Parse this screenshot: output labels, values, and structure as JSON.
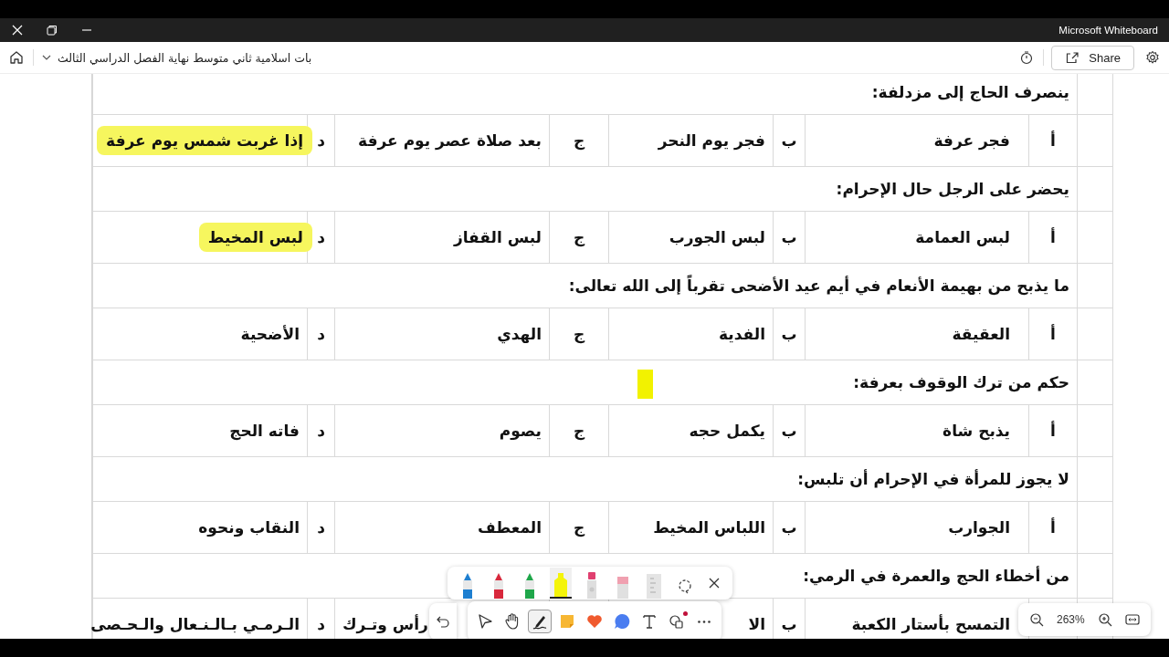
{
  "window": {
    "title": "Microsoft Whiteboard"
  },
  "header": {
    "board_name": "بات اسلامية ثاني متوسط نهاية الفصل الدراسي الثالث",
    "share_button": "Share"
  },
  "questions": [
    {
      "text": "ينصرف الحاج إلى مزدلفة:",
      "options": [
        {
          "letter": "أ",
          "text": "فجر عرفة",
          "highlighted": false
        },
        {
          "letter": "ب",
          "text": "فجر يوم النحر",
          "highlighted": false
        },
        {
          "letter": "ج",
          "text": "بعد صلاة عصر يوم عرفة",
          "highlighted": false
        },
        {
          "letter": "د",
          "text": "إذا غربت شمس يوم عرفة",
          "highlighted": true
        }
      ]
    },
    {
      "text": "يحضر على الرجل حال الإحرام:",
      "options": [
        {
          "letter": "أ",
          "text": "لبس العمامة",
          "highlighted": false
        },
        {
          "letter": "ب",
          "text": "لبس الجورب",
          "highlighted": false
        },
        {
          "letter": "ج",
          "text": "لبس القفاز",
          "highlighted": false
        },
        {
          "letter": "د",
          "text": "لبس المخيط",
          "highlighted": true
        }
      ]
    },
    {
      "text": "ما يذبح من بهيمة الأنعام في أيم عيد الأضحى تقرباً إلى الله تعالى:",
      "options": [
        {
          "letter": "أ",
          "text": "العقيقة",
          "highlighted": false
        },
        {
          "letter": "ب",
          "text": "الفدية",
          "highlighted": false
        },
        {
          "letter": "ج",
          "text": "الهدي",
          "highlighted": false
        },
        {
          "letter": "د",
          "text": "الأضحية",
          "highlighted": false
        }
      ]
    },
    {
      "text": "حكم من ترك الوقوف بعرفة:",
      "options": [
        {
          "letter": "أ",
          "text": "يذبح شاة",
          "highlighted": false
        },
        {
          "letter": "ب",
          "text": "يكمل حجه",
          "highlighted": false
        },
        {
          "letter": "ج",
          "text": "يصوم",
          "highlighted": false
        },
        {
          "letter": "د",
          "text": "فاته الحج",
          "highlighted": false
        }
      ]
    },
    {
      "text": "لا يجوز للمرأة في الإحرام أن تلبس:",
      "options": [
        {
          "letter": "أ",
          "text": "الجوارب",
          "highlighted": false
        },
        {
          "letter": "ب",
          "text": "اللباس المخيط",
          "highlighted": false
        },
        {
          "letter": "ج",
          "text": "المعطف",
          "highlighted": false
        },
        {
          "letter": "د",
          "text": "النقاب ونحوه",
          "highlighted": false
        }
      ]
    },
    {
      "text": "من أخطاء الحج والعمرة في الرمي:",
      "options": [
        {
          "text": "التمسح بأستار الكعبة",
          "highlighted": false
        },
        {
          "letter": "ب",
          "text": "الا",
          "highlighted": false
        },
        {
          "text": "رأس وتـرك",
          "highlighted": false
        },
        {
          "letter": "د",
          "text": "الـرمـي بـالـنـعال والـحـصى",
          "highlighted": false
        }
      ]
    }
  ],
  "pen_tray": [
    {
      "kind": "pen",
      "color": "#1e7fd0",
      "selected": false
    },
    {
      "kind": "pen",
      "color": "#d8283c",
      "selected": false
    },
    {
      "kind": "pen",
      "color": "#1fa64a",
      "selected": false
    },
    {
      "kind": "highlighter",
      "color": "#f4f40a",
      "selected": true
    },
    {
      "kind": "marker",
      "color": "#e04070",
      "selected": false
    },
    {
      "kind": "eraser",
      "color": "#f0a0b0",
      "selected": false
    },
    {
      "kind": "ruler",
      "selected": false
    },
    {
      "kind": "lasso",
      "selected": false
    }
  ],
  "toolbar": [
    {
      "kind": "select",
      "selected": false
    },
    {
      "kind": "hand",
      "selected": false
    },
    {
      "kind": "ink",
      "selected": true
    },
    {
      "kind": "note",
      "selected": false
    },
    {
      "kind": "reaction",
      "selected": false
    },
    {
      "kind": "comment",
      "selected": false
    },
    {
      "kind": "text",
      "selected": false
    },
    {
      "kind": "shapes",
      "selected": false,
      "dot": true
    },
    {
      "kind": "more",
      "selected": false
    }
  ],
  "zoom": {
    "level_text": "263%"
  }
}
